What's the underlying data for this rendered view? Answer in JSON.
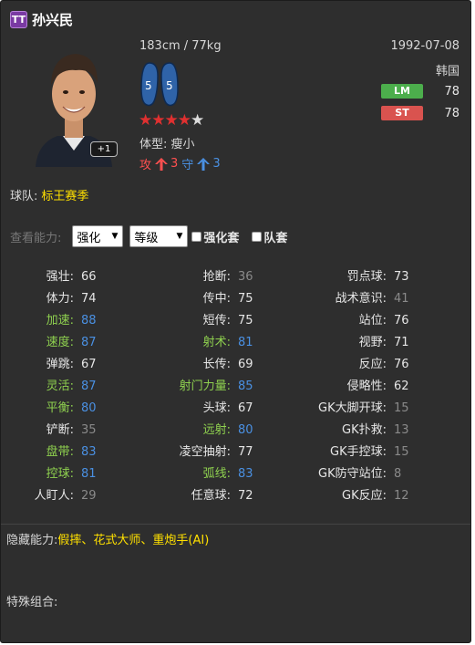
{
  "header": {
    "badge_text": "TT",
    "name": "孙兴民"
  },
  "profile": {
    "height_weight": "183cm / 77kg",
    "birthdate": "1992-07-08",
    "nation": "韩国",
    "boost": "+1",
    "weak_foot": {
      "left": "5",
      "right": "5"
    },
    "positions": [
      {
        "pos": "LM",
        "rating": "78",
        "color": "#4cae4c"
      },
      {
        "pos": "ST",
        "rating": "78",
        "color": "#d9534f"
      }
    ],
    "stars": {
      "filled": 4,
      "total": 5
    },
    "body_type": "体型: 瘦小",
    "workrate": {
      "att_label": "攻",
      "att_value": "3",
      "def_label": "守",
      "def_value": "3"
    }
  },
  "team": {
    "label": "球队:",
    "value": "标王赛季"
  },
  "view": {
    "label": "查看能力:",
    "select_enhance": "强化",
    "select_level": "等级",
    "checkbox_enhance_set": "强化套",
    "checkbox_team_set": "队套"
  },
  "colors": {
    "normal": "#e6e6e6",
    "boosted": "#8fd14f",
    "high": "#4a90e2",
    "low": "#8a8a8a"
  },
  "stats": [
    [
      {
        "label": "强壮:",
        "value": "66",
        "lc": "normal",
        "vc": "normal"
      },
      {
        "label": "体力:",
        "value": "74",
        "lc": "normal",
        "vc": "normal"
      },
      {
        "label": "加速:",
        "value": "88",
        "lc": "boosted",
        "vc": "high"
      },
      {
        "label": "速度:",
        "value": "87",
        "lc": "boosted",
        "vc": "high"
      },
      {
        "label": "弹跳:",
        "value": "67",
        "lc": "normal",
        "vc": "normal"
      },
      {
        "label": "灵活:",
        "value": "87",
        "lc": "boosted",
        "vc": "high"
      },
      {
        "label": "平衡:",
        "value": "80",
        "lc": "boosted",
        "vc": "high"
      },
      {
        "label": "铲断:",
        "value": "35",
        "lc": "normal",
        "vc": "low"
      },
      {
        "label": "盘带:",
        "value": "83",
        "lc": "boosted",
        "vc": "high"
      },
      {
        "label": "控球:",
        "value": "81",
        "lc": "boosted",
        "vc": "high"
      },
      {
        "label": "人盯人:",
        "value": "29",
        "lc": "normal",
        "vc": "low"
      }
    ],
    [
      {
        "label": "抢断:",
        "value": "36",
        "lc": "normal",
        "vc": "low"
      },
      {
        "label": "传中:",
        "value": "75",
        "lc": "normal",
        "vc": "normal"
      },
      {
        "label": "短传:",
        "value": "75",
        "lc": "normal",
        "vc": "normal"
      },
      {
        "label": "射术:",
        "value": "81",
        "lc": "boosted",
        "vc": "high"
      },
      {
        "label": "长传:",
        "value": "69",
        "lc": "normal",
        "vc": "normal"
      },
      {
        "label": "射门力量:",
        "value": "85",
        "lc": "boosted",
        "vc": "high"
      },
      {
        "label": "头球:",
        "value": "67",
        "lc": "normal",
        "vc": "normal"
      },
      {
        "label": "远射:",
        "value": "80",
        "lc": "boosted",
        "vc": "high"
      },
      {
        "label": "凌空抽射:",
        "value": "77",
        "lc": "normal",
        "vc": "normal"
      },
      {
        "label": "弧线:",
        "value": "83",
        "lc": "boosted",
        "vc": "high"
      },
      {
        "label": "任意球:",
        "value": "72",
        "lc": "normal",
        "vc": "normal"
      }
    ],
    [
      {
        "label": "罚点球:",
        "value": "73",
        "lc": "normal",
        "vc": "normal"
      },
      {
        "label": "战术意识:",
        "value": "41",
        "lc": "normal",
        "vc": "low"
      },
      {
        "label": "站位:",
        "value": "76",
        "lc": "normal",
        "vc": "normal"
      },
      {
        "label": "视野:",
        "value": "71",
        "lc": "normal",
        "vc": "normal"
      },
      {
        "label": "反应:",
        "value": "76",
        "lc": "normal",
        "vc": "normal"
      },
      {
        "label": "侵略性:",
        "value": "62",
        "lc": "normal",
        "vc": "normal"
      },
      {
        "label": "GK大脚开球:",
        "value": "15",
        "lc": "normal",
        "vc": "low"
      },
      {
        "label": "GK扑救:",
        "value": "13",
        "lc": "normal",
        "vc": "low"
      },
      {
        "label": "GK手控球:",
        "value": "15",
        "lc": "normal",
        "vc": "low"
      },
      {
        "label": "GK防守站位:",
        "value": "8",
        "lc": "normal",
        "vc": "low"
      },
      {
        "label": "GK反应:",
        "value": "12",
        "lc": "normal",
        "vc": "low"
      }
    ]
  ],
  "hidden": {
    "label": "隐藏能力:",
    "value": "假摔、花式大师、重炮手(AI)"
  },
  "combo": {
    "label": "特殊组合:"
  }
}
